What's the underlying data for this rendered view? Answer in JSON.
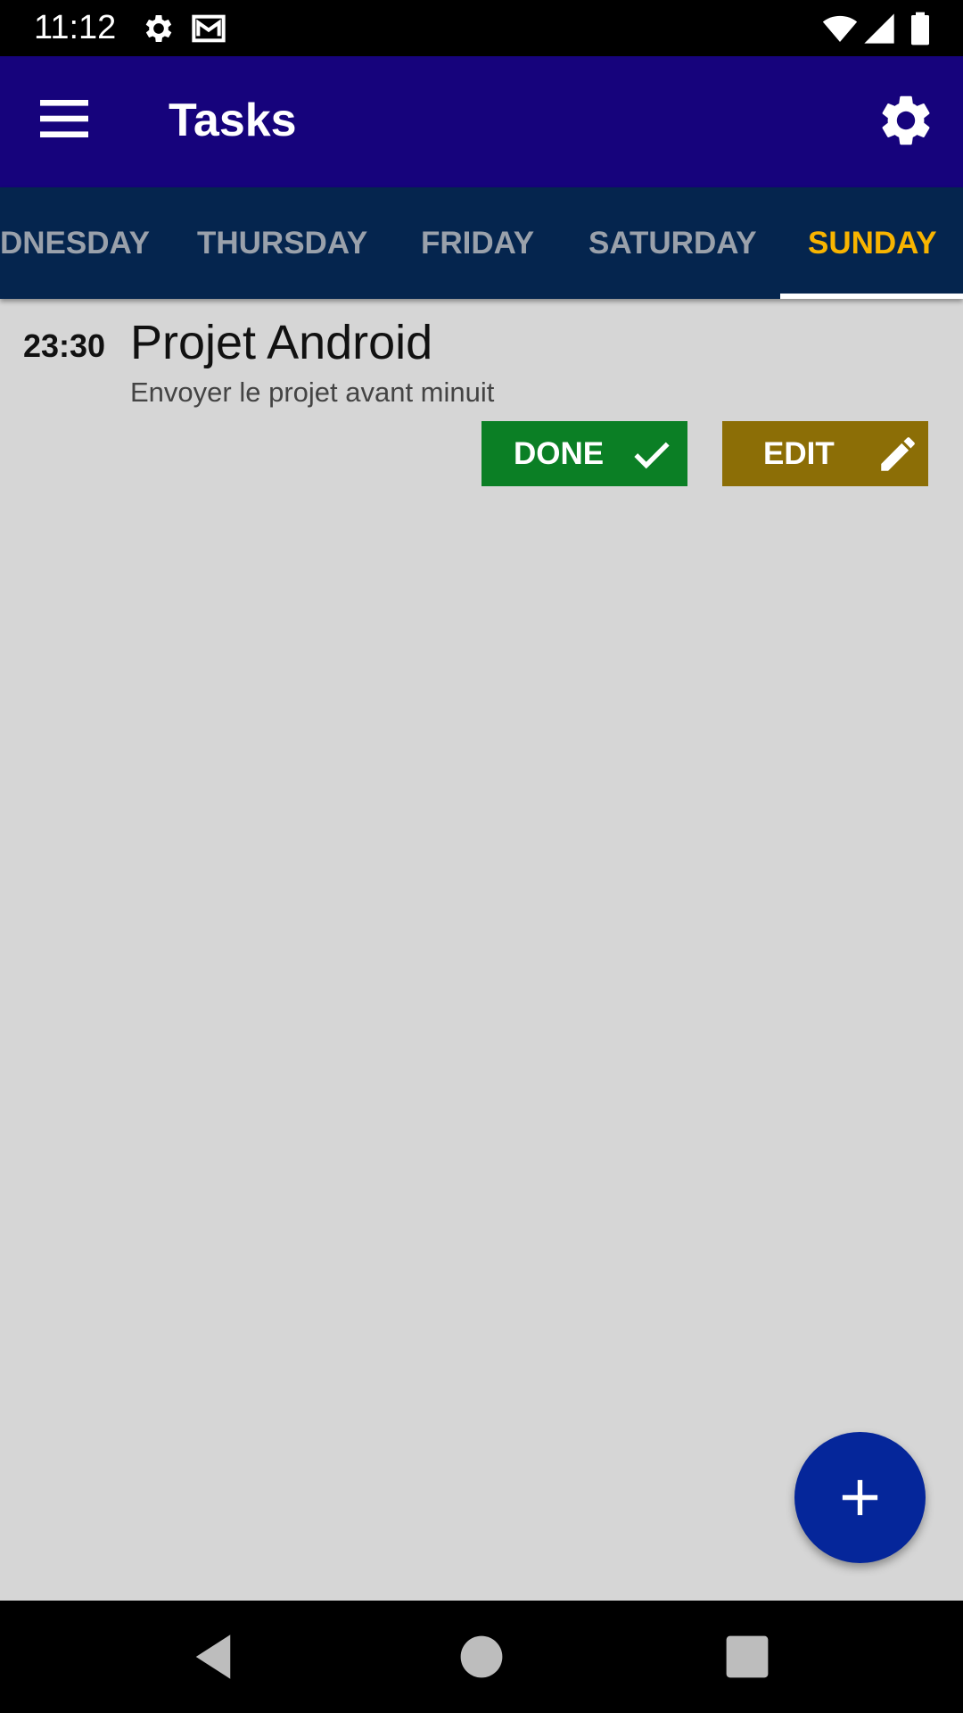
{
  "status_bar": {
    "time": "11:12",
    "icons": [
      "settings-icon",
      "gmail-icon",
      "wifi-icon",
      "signal-icon",
      "battery-icon"
    ]
  },
  "app_bar": {
    "title": "Tasks",
    "menu_icon": "menu-icon",
    "settings_icon": "gear-icon"
  },
  "tabs": [
    {
      "label": "DNESDAY",
      "active": false
    },
    {
      "label": "THURSDAY",
      "active": false
    },
    {
      "label": "FRIDAY",
      "active": false
    },
    {
      "label": "SATURDAY",
      "active": false
    },
    {
      "label": "SUNDAY",
      "active": true
    }
  ],
  "tasks": [
    {
      "time": "23:30",
      "title": "Projet Android",
      "description": "Envoyer le projet avant minuit",
      "done_label": "DONE",
      "edit_label": "EDIT"
    }
  ],
  "fab": {
    "icon": "plus-icon"
  },
  "nav_bar": {
    "icons": [
      "back-icon",
      "home-icon",
      "recents-icon"
    ]
  },
  "colors": {
    "app_bar": "#16037c",
    "tab_bar": "#05254e",
    "active_tab": "#f8b400",
    "done": "#0b7f25",
    "edit": "#8c6e06",
    "fab": "#05269a",
    "background": "#d6d6d6"
  }
}
